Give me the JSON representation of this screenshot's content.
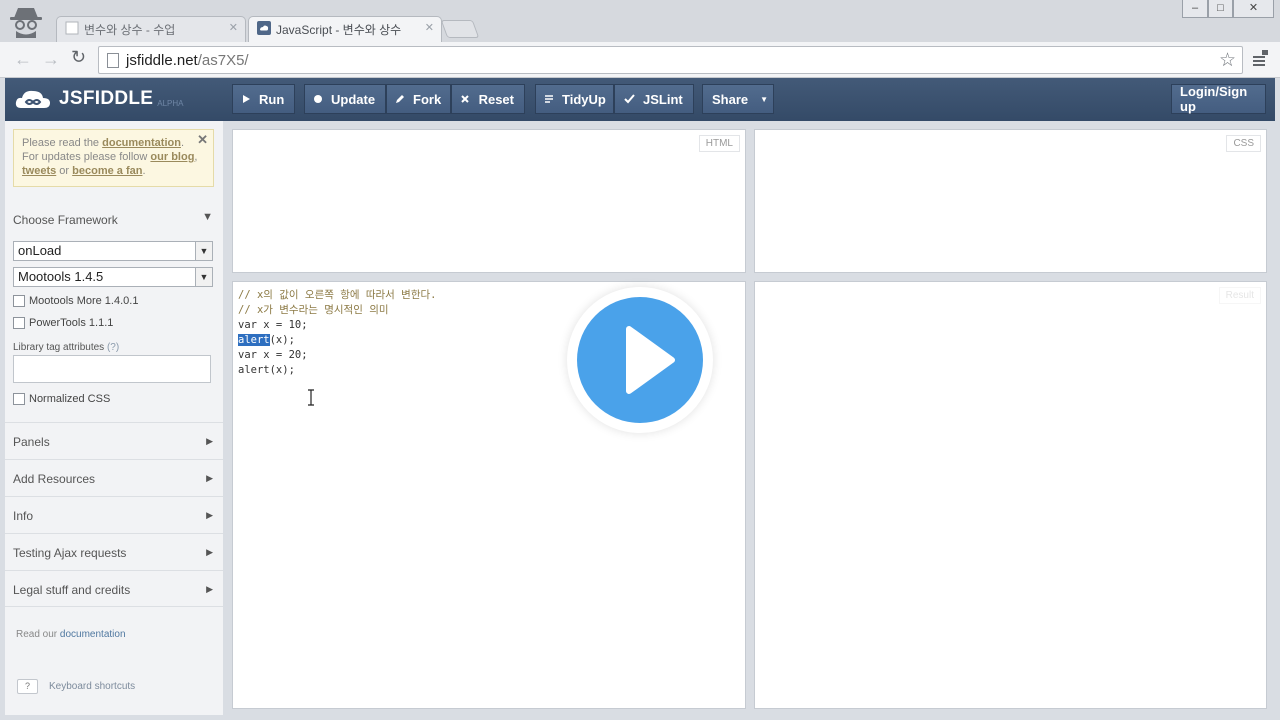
{
  "browser": {
    "tabs": [
      {
        "title": "변수와 상수 - 수업",
        "active": false
      },
      {
        "title": "JavaScript - 변수와 상수",
        "active": true
      }
    ],
    "url_host": "jsfiddle.net",
    "url_path": "/as7X5/",
    "window_controls": [
      "–",
      "□",
      "✕"
    ]
  },
  "header": {
    "logo_name": "JSFIDDLE",
    "logo_badge": "ALPHA",
    "buttons": {
      "run": "Run",
      "update": "Update",
      "fork": "Fork",
      "reset": "Reset",
      "tidyup": "TidyUp",
      "jslint": "JSLint",
      "share": "Share",
      "login": "Login/Sign up"
    }
  },
  "sidebar": {
    "notice": {
      "t1": "Please read the ",
      "doc_link": "documentation",
      "t2": ".",
      "t3": "For updates please follow ",
      "blog_link": "our blog",
      "t4": ",",
      "tweets_link": "tweets",
      "t5": " or ",
      "fan_link": "become a fan",
      "t6": "."
    },
    "choose_framework": "Choose Framework",
    "load_type": "onLoad",
    "framework": "Mootools 1.4.5",
    "mootools_more": "Mootools More 1.4.0.1",
    "powertools": "PowerTools 1.1.1",
    "library_tag_label": "Library tag attributes",
    "library_tag_help": "(?)",
    "normalized_css": "Normalized CSS",
    "sections": [
      "Panels",
      "Add Resources",
      "Info",
      "Testing Ajax requests",
      "Legal stuff and credits"
    ],
    "read_doc_prefix": "Read our ",
    "read_doc_link": "documentation",
    "shortcut_key": "?",
    "shortcuts_label": "Keyboard shortcuts"
  },
  "panels": {
    "html_label": "HTML",
    "css_label": "CSS",
    "result_label": "Result",
    "js_code": {
      "line1": "// x의 값이 오른쪽 항에 따라서 변한다.",
      "line2": "// x가 변수라는 명시적인 의미",
      "line3": "var x = 10;",
      "line4_sel": "alert",
      "line4_rest": "(x);",
      "line5": "var x = 20;",
      "line6": "alert(x);"
    }
  },
  "colors": {
    "header_bg": "#3d5372",
    "play_button": "#4aa2ea",
    "selection": "#2e6fc0"
  }
}
